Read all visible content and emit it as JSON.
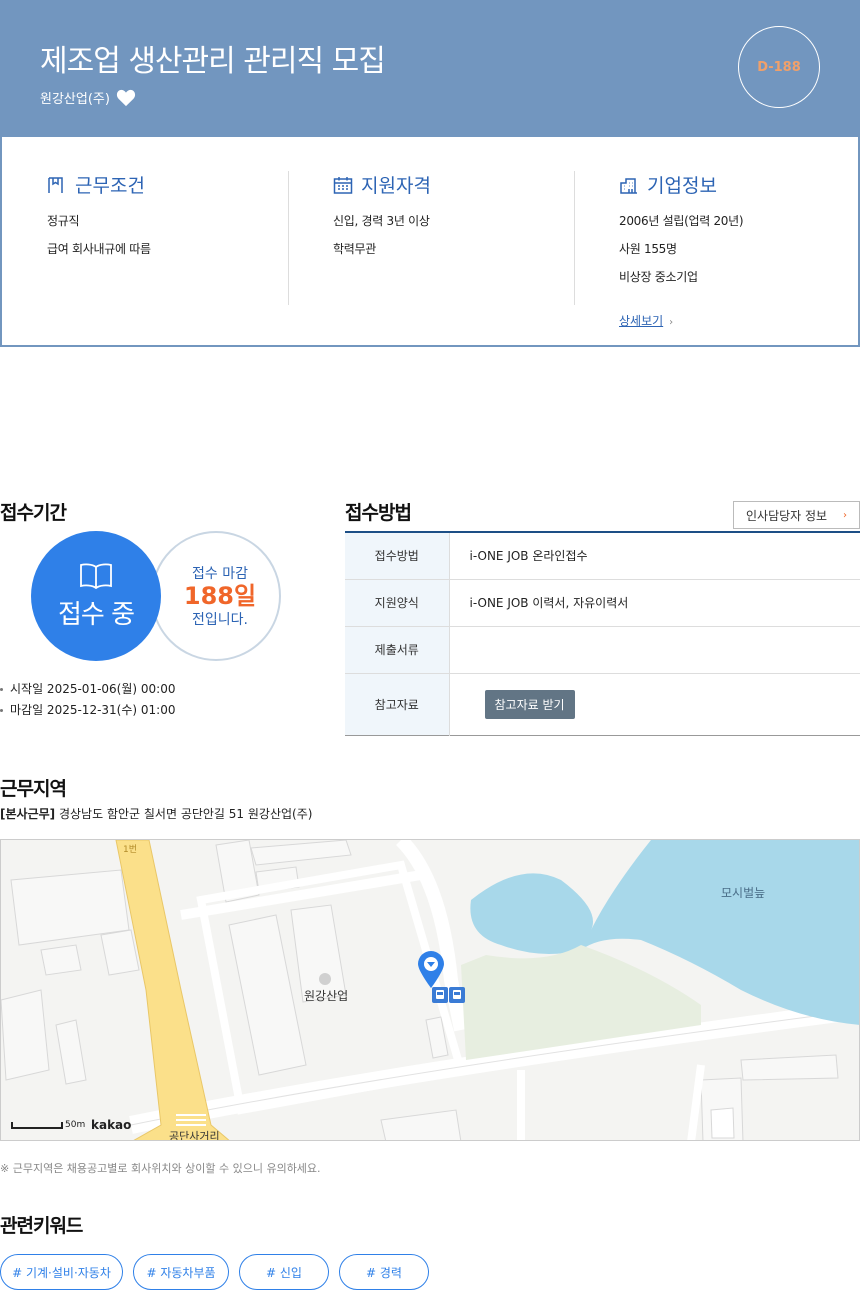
{
  "header": {
    "title": "제조업 생산관리 관리직 모집",
    "company": "원강산업(주)",
    "dday": "D-188"
  },
  "info": {
    "conditions": {
      "title": "근무조건",
      "lines": [
        "정규직",
        "급여 회사내규에 따름"
      ]
    },
    "qualifications": {
      "title": "지원자격",
      "lines": [
        "신입, 경력 3년 이상",
        "학력무관"
      ]
    },
    "company": {
      "title": "기업정보",
      "lines": [
        "2006년 설립(업력 20년)",
        "사원 155명",
        "비상장 중소기업"
      ],
      "more": "상세보기"
    }
  },
  "period": {
    "title": "접수기간",
    "status": "접수 중",
    "deadline_prefix": "접수 마감",
    "deadline_days": "188일",
    "deadline_suffix": "전입니다.",
    "start": "시작일 2025-01-06(월) 00:00",
    "end": "마감일 2025-12-31(수) 01:00"
  },
  "method": {
    "title": "접수방법",
    "hr_button": "인사담당자 정보",
    "rows": [
      {
        "key": "접수방법",
        "value": "i-ONE JOB 온라인접수"
      },
      {
        "key": "지원양식",
        "value": "i-ONE JOB 이력서, 자유이력서"
      },
      {
        "key": "제출서류",
        "value": ""
      },
      {
        "key": "참고자료",
        "button": "참고자료 받기"
      }
    ]
  },
  "location": {
    "title": "근무지역",
    "tag": "[본사근무]",
    "address": "경상남도 함안군 칠서면 공단안길 51 원강산업(주)",
    "map": {
      "place_label": "원강산업",
      "lake_label": "모시벌늪",
      "crossroad_label": "공단사거리",
      "scale_label": "50m",
      "provider": "kakao",
      "road_label": "1번"
    },
    "notice": "※ 근무지역은 채용공고별로 회사위치와 상이할 수 있으니 유의하세요."
  },
  "keywords": {
    "title": "관련키워드",
    "items": [
      "# 기계·설비·자동차",
      "# 자동차부품",
      "# 신입",
      "# 경력"
    ]
  }
}
